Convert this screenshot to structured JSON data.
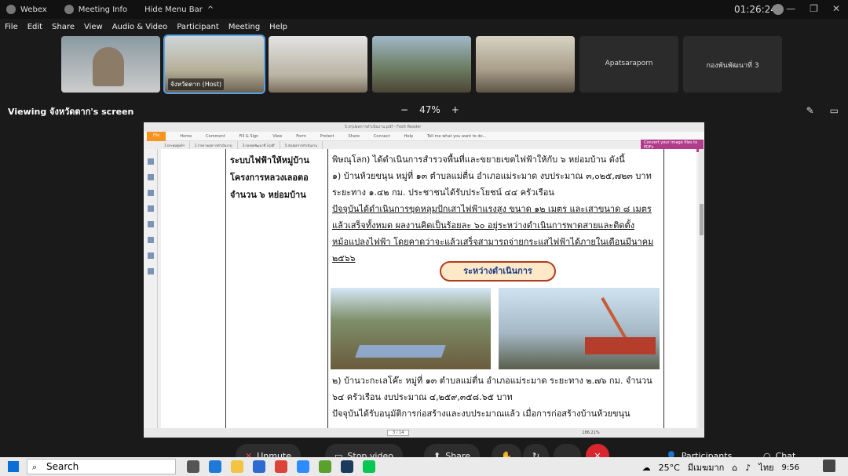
{
  "topbar": {
    "app": "Webex",
    "meeting_info": "Meeting Info",
    "hide_menu": "Hide Menu Bar",
    "timer": "01:26:24",
    "win_min": "—",
    "win_max": "❐",
    "win_close": "✕"
  },
  "menu": [
    "File",
    "Edit",
    "Share",
    "View",
    "Audio & Video",
    "Participant",
    "Meeting",
    "Help"
  ],
  "participants": [
    {
      "label": "",
      "type": "person"
    },
    {
      "label": "จังหวัดตาก (Host)",
      "type": "room",
      "host": true
    },
    {
      "label": "",
      "type": "room"
    },
    {
      "label": "",
      "type": "room"
    },
    {
      "label": "",
      "type": "room"
    },
    {
      "label": "Apatsaraporn",
      "type": "name"
    },
    {
      "label": "กองพันพัฒนาที่ 3",
      "type": "name"
    }
  ],
  "viewbar": {
    "viewing": "Viewing จังหวัดตาก's screen",
    "zoom_minus": "−",
    "zoom_value": "47%",
    "zoom_plus": "+"
  },
  "pdf": {
    "window_title": "5.สรุปผลการดำเนินงาน.pdf - Foxit Reader",
    "ribbon": [
      "File",
      "Home",
      "Comment",
      "Fill & Sign",
      "View",
      "Form",
      "Protect",
      "Share",
      "Connect",
      "Help",
      "Tell me what you want to do..."
    ],
    "tabs": [
      "1.ประชุมศูนย์ฯ",
      "2.รายงานผลการดำเนินงาน",
      "3.กองพลพัฒนาที่ 3.pdf",
      "5.สรุปผลการดำเนินงาน"
    ],
    "convert": "Convert your image files to PDFs",
    "left_cell": "ระบบไฟฟ้าให้หมู่บ้าน โครงการหลวงเลอตอ จำนวน ๖ หย่อมบ้าน",
    "para1": "พิษณุโลก) ได้ดำเนินการสำรวจพื้นที่และขยายเขตไฟฟ้าให้กับ ๖ หย่อมบ้าน ดังนี้",
    "para2": "๑) บ้านห้วยขนุน หมู่ที่ ๑๓ ตำบลแม่ตื่น อำเภอแม่ระมาด งบประมาณ ๓,๐๒๕,๗๒๓ บาท ระยะทาง ๑.๔๒ กม. ประชาชนได้รับประโยชน์ ๔๔ ครัวเรือน",
    "para3": "ปัจจุบันได้ดำเนินการขุดหลุมปักเสาไฟฟ้าแรงสูง ขนาด ๑๒ เมตร และเสาขนาด ๘ เมตร แล้วเสร็จทั้งหมด ผลงานคิดเป็นร้อยละ ๖๐ อยู่ระหว่างดำเนินการพาดสายและติดตั้งหม้อแปลงไฟฟ้า โดยคาดว่าจะแล้วเสร็จสามารถจ่ายกระแสไฟฟ้าได้ภายในเดือนมีนาคม ๒๕๖๖",
    "status_pill": "ระหว่างดำเนินการ",
    "para4": "๒) บ้านวะกะเลโค๊ะ หมู่ที่ ๑๓ ตำบลแม่ตื่น อำเภอแม่ระมาด ระยะทาง ๒.๗๖ กม. จำนวน ๖๔ ครัวเรือน งบประมาณ ๔,๒๕๙,๓๕๘.๖๕ บาท",
    "para5": "ปัจจุบันได้รับอนุมัติการก่อสร้างและงบประมาณแล้ว เมื่อการก่อสร้างบ้านห้วยขนุน",
    "page_indicator": "3 / 14",
    "zoom": "186.21%"
  },
  "controls": {
    "unmute": "Unmute",
    "stop_video": "Stop video",
    "share": "Share",
    "participants": "Participants",
    "chat": "Chat"
  },
  "taskbar": {
    "search": "Search",
    "weather": "25°C",
    "weather_desc": "มีเมฆมาก",
    "lang": "ไทย",
    "time": "9:56"
  },
  "colors": {
    "accent": "#5aa1e6",
    "end_call": "#d7262e",
    "foxit_orange": "#f7941e"
  }
}
